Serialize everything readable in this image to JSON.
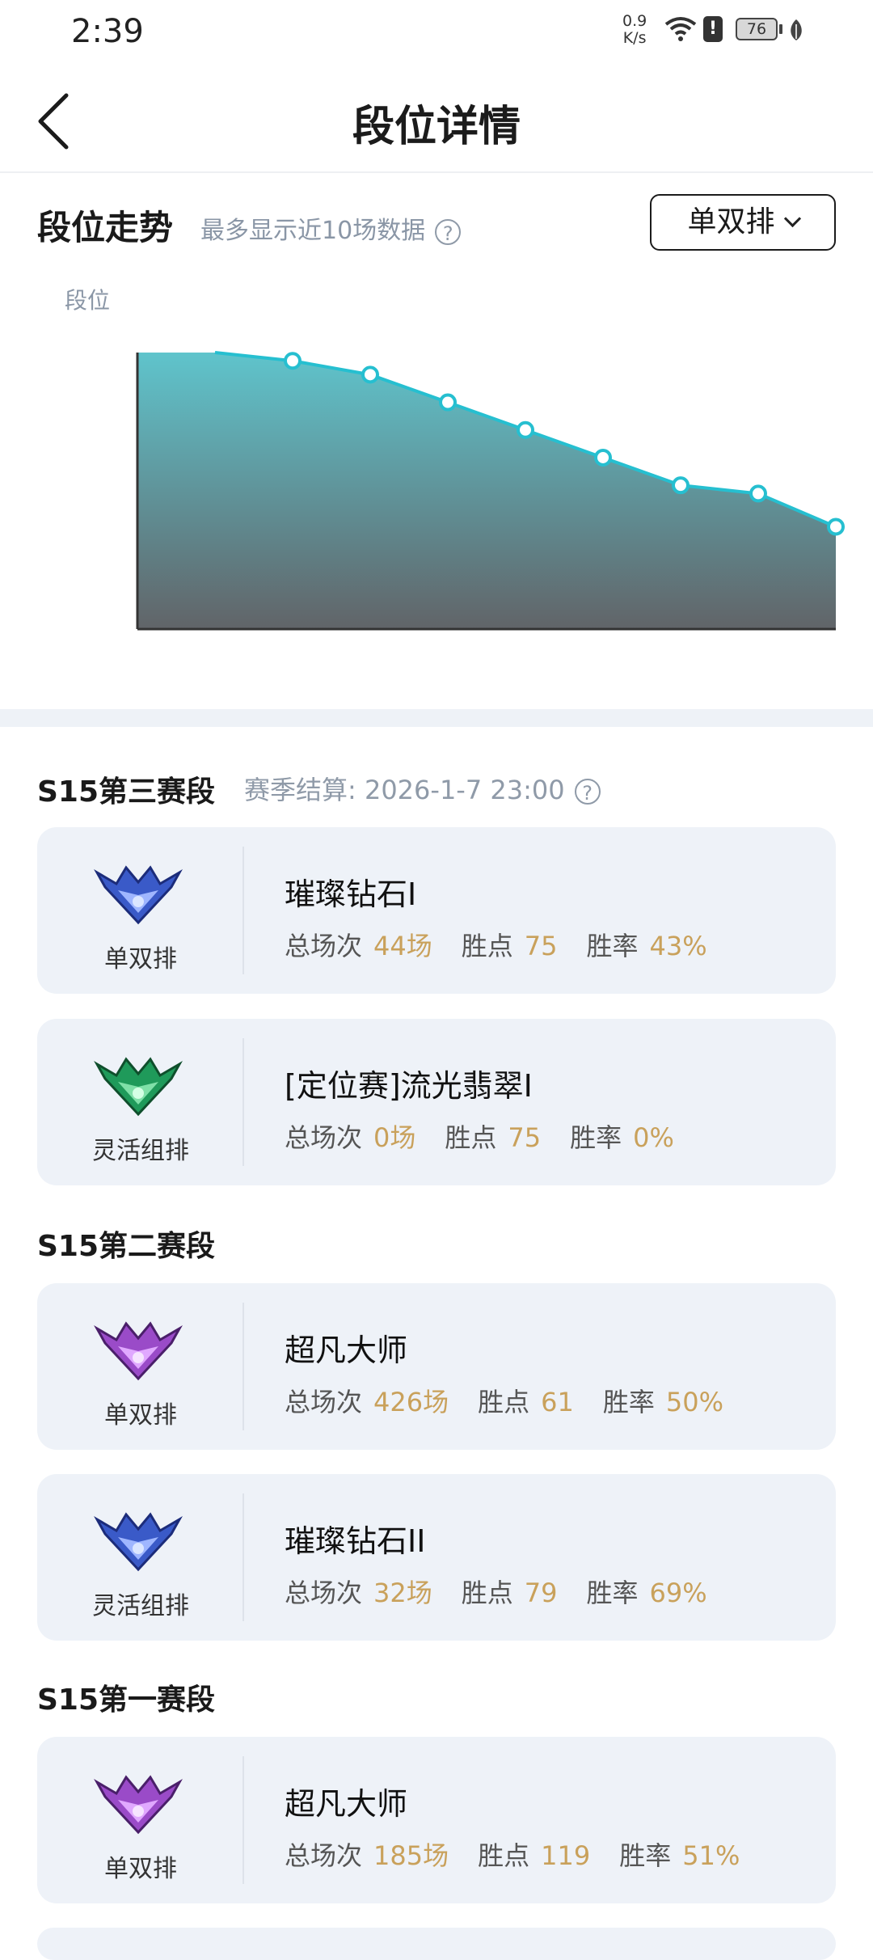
{
  "status_bar": {
    "time": "2:39",
    "net_speed_value": "0.9",
    "net_speed_unit": "K/s",
    "battery": "76",
    "icons": [
      "wifi-icon",
      "alert-icon",
      "battery-icon",
      "leaf-icon"
    ]
  },
  "header": {
    "title": "段位详情",
    "back_icon": "chevron-left-icon"
  },
  "trend": {
    "title": "段位走势",
    "hint": "最多显示近10场数据",
    "mode_select": "单双排",
    "y_axis_label": "段位"
  },
  "chart_data": {
    "type": "area",
    "ylabel": "段位",
    "x": [
      1,
      2,
      3,
      4,
      5,
      6,
      7,
      8,
      9,
      10
    ],
    "values": [
      100,
      100,
      97,
      92,
      82,
      72,
      62,
      52,
      49,
      37
    ],
    "ylim": [
      0,
      100
    ],
    "markers_from_index": 2,
    "colors": {
      "line": "#26bfd0",
      "fill_top": "#5fc4cc",
      "fill_bottom": "#616468"
    }
  },
  "seasons": [
    {
      "title": "S15第三赛段",
      "note": "赛季结算: 2026-1-7 23:00",
      "cards": [
        {
          "queue": "单双排",
          "rank": "璀璨钻石I",
          "badge": "diamond-badge-icon",
          "games_label": "总场次",
          "games": "44场",
          "lp_label": "胜点",
          "lp": "75",
          "wr_label": "胜率",
          "wr": "43%"
        },
        {
          "queue": "灵活组排",
          "rank": "[定位赛]流光翡翠I",
          "badge": "emerald-badge-icon",
          "games_label": "总场次",
          "games": "0场",
          "lp_label": "胜点",
          "lp": "75",
          "wr_label": "胜率",
          "wr": "0%"
        }
      ]
    },
    {
      "title": "S15第二赛段",
      "note": "",
      "cards": [
        {
          "queue": "单双排",
          "rank": "超凡大师",
          "badge": "master-badge-icon",
          "games_label": "总场次",
          "games": "426场",
          "lp_label": "胜点",
          "lp": "61",
          "wr_label": "胜率",
          "wr": "50%"
        },
        {
          "queue": "灵活组排",
          "rank": "璀璨钻石II",
          "badge": "diamond-badge-icon",
          "games_label": "总场次",
          "games": "32场",
          "lp_label": "胜点",
          "lp": "79",
          "wr_label": "胜率",
          "wr": "69%"
        }
      ]
    },
    {
      "title": "S15第一赛段",
      "note": "",
      "cards": [
        {
          "queue": "单双排",
          "rank": "超凡大师",
          "badge": "master-badge-icon",
          "games_label": "总场次",
          "games": "185场",
          "lp_label": "胜点",
          "lp": "119",
          "wr_label": "胜率",
          "wr": "51%"
        }
      ]
    }
  ],
  "colors": {
    "accent_value": "#c9a15b",
    "card_bg": "#eef2f8",
    "hint_gray": "#8f9aa8"
  }
}
